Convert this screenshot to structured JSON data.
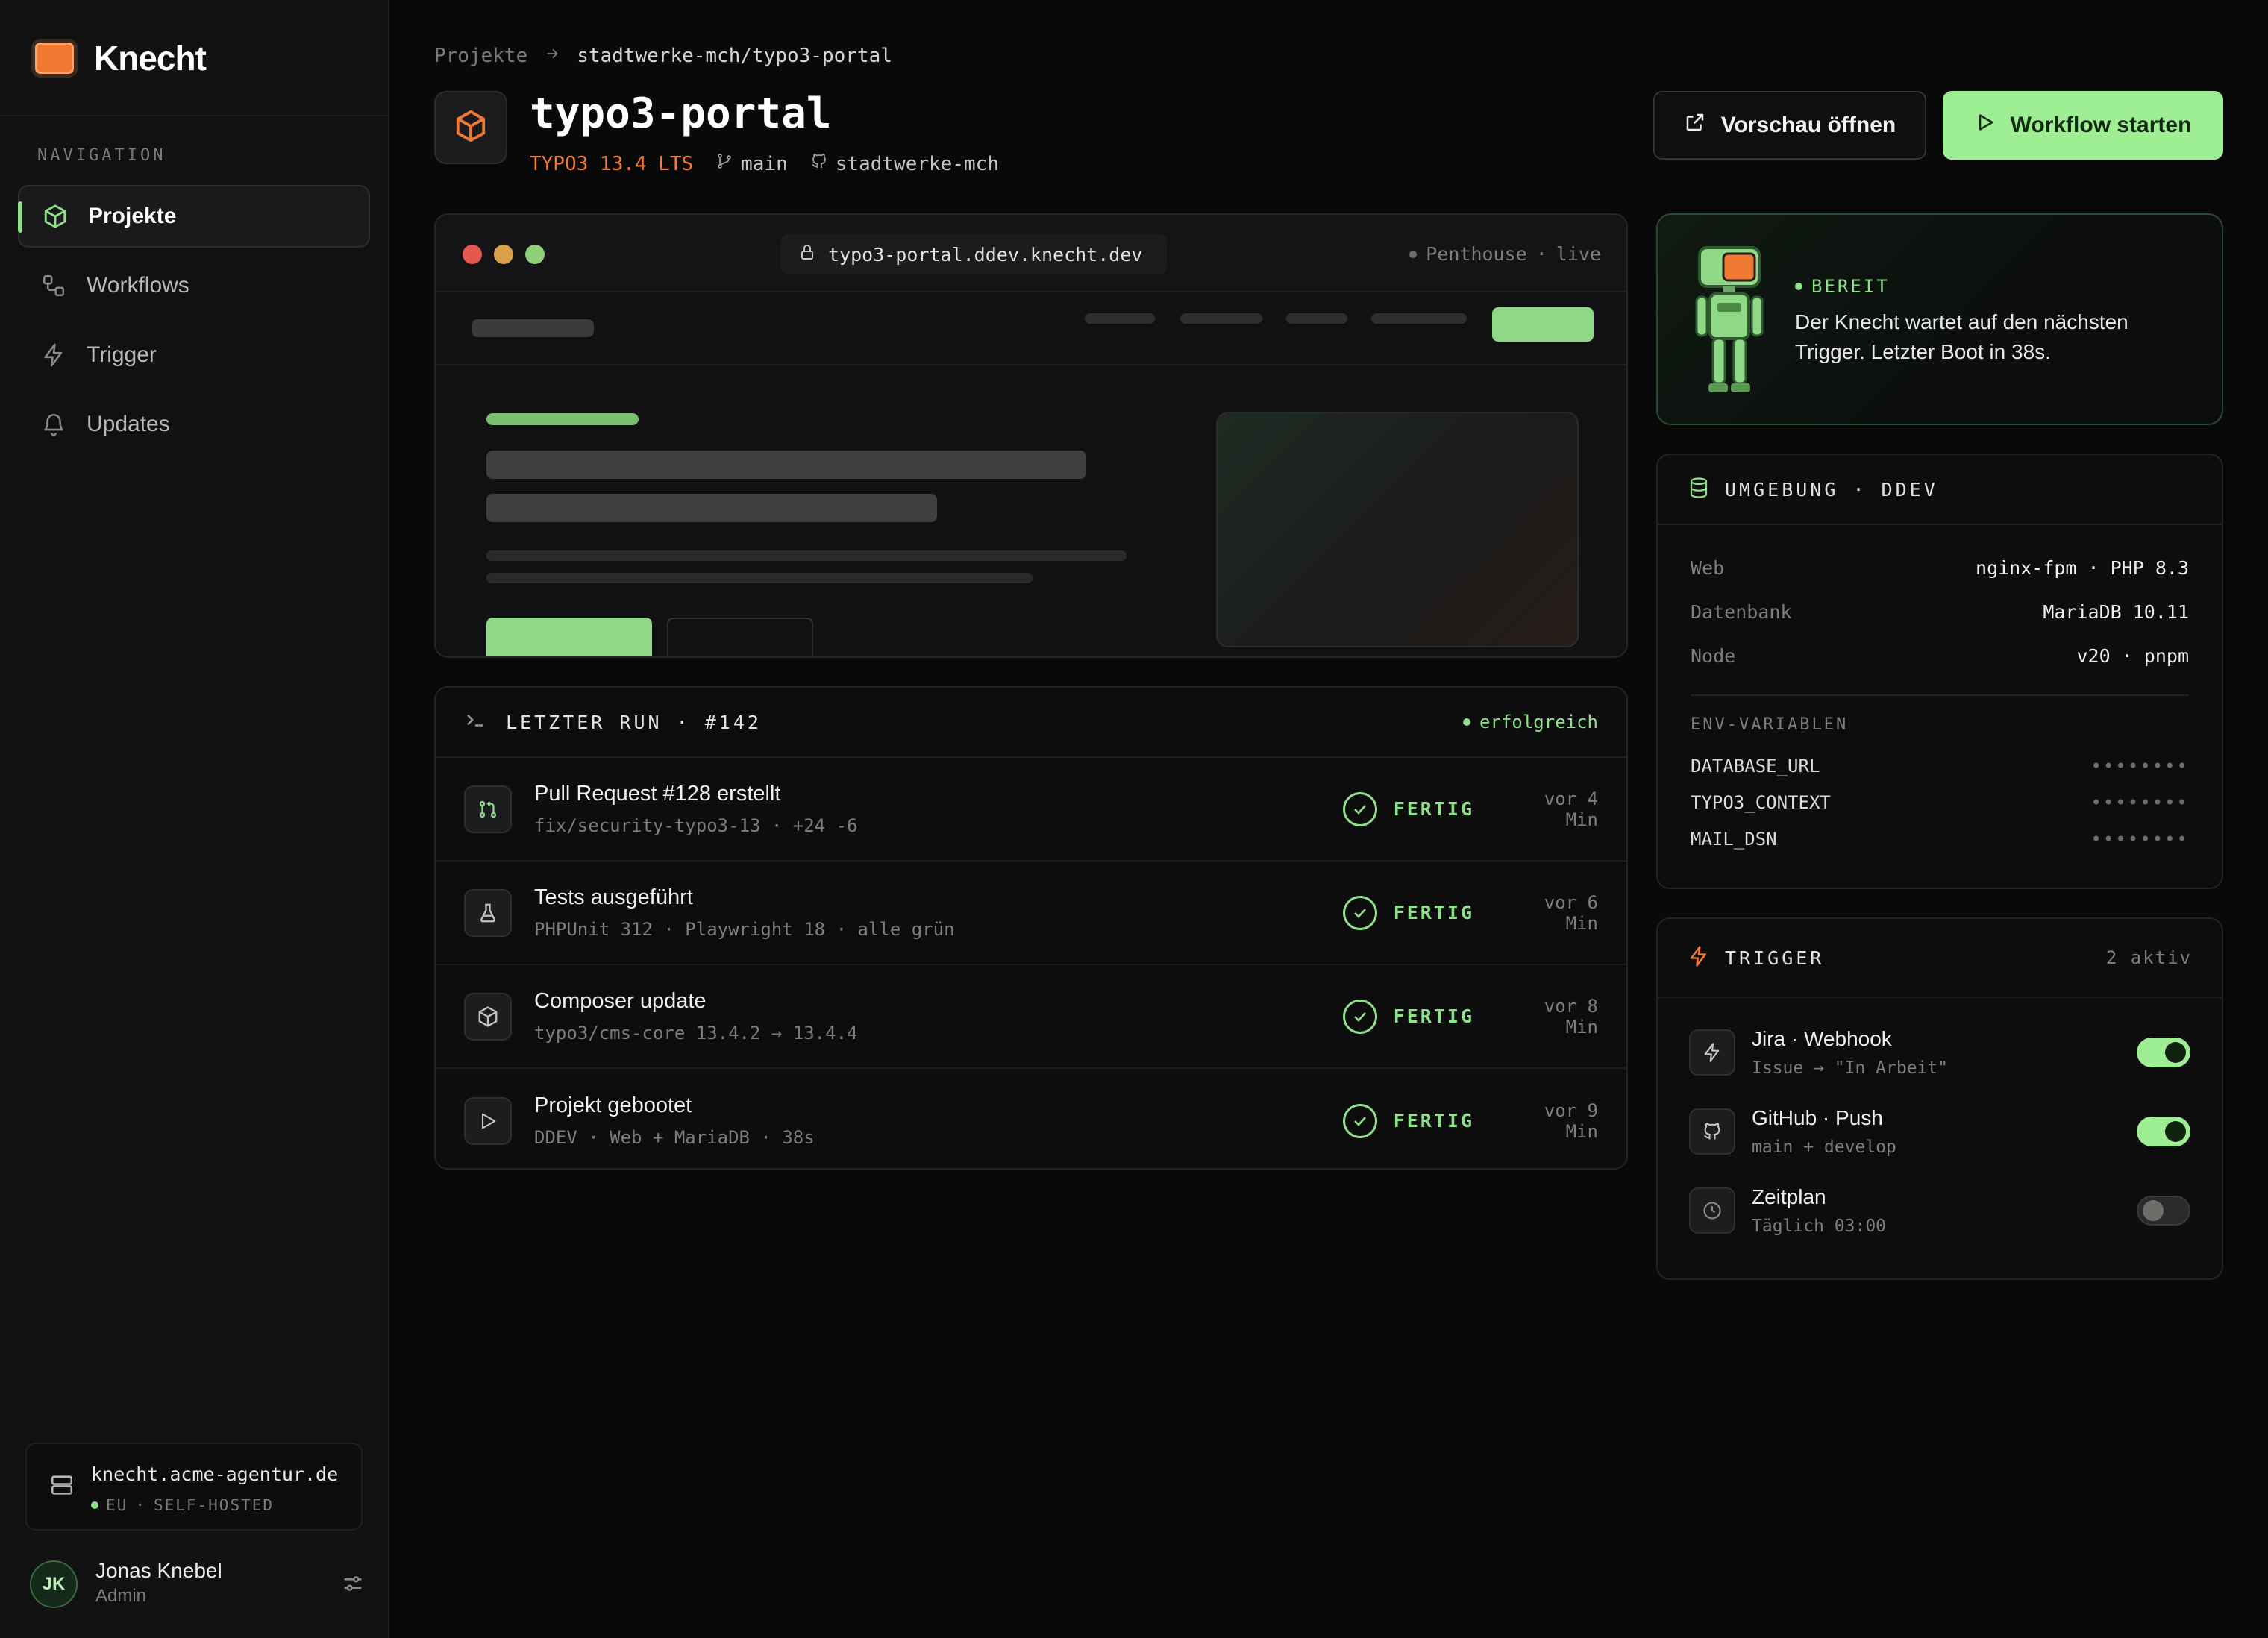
{
  "brand": {
    "name": "Knecht",
    "accent": "#f07a32"
  },
  "sidebar": {
    "heading": "NAVIGATION",
    "items": [
      {
        "label": "Projekte",
        "icon": "box-icon",
        "active": true
      },
      {
        "label": "Workflows",
        "icon": "workflow-icon",
        "active": false
      },
      {
        "label": "Trigger",
        "icon": "lightning-icon",
        "active": false
      },
      {
        "label": "Updates",
        "icon": "bell-icon",
        "active": false
      }
    ],
    "server": {
      "host": "knecht.acme-agentur.de",
      "region": "EU",
      "mode": "SELF-HOSTED"
    },
    "user": {
      "initials": "JK",
      "name": "Jonas Knebel",
      "role": "Admin"
    }
  },
  "header": {
    "breadcrumb": {
      "root": "Projekte",
      "current": "stadtwerke-mch/typo3-portal"
    },
    "title": "typo3-portal",
    "version": "TYPO3 13.4 LTS",
    "branch": "main",
    "org": "stadtwerke-mch",
    "preview_button": "Vorschau öffnen",
    "workflow_button": "Workflow starten"
  },
  "preview": {
    "url": "typo3-portal.ddev.knecht.dev",
    "server_name": "Penthouse",
    "state": "live"
  },
  "run": {
    "title": "LETZTER RUN · #142",
    "status": "erfolgreich",
    "steps": [
      {
        "title": "Pull Request #128 erstellt",
        "sub": "fix/security-typo3-13 · +24 -6",
        "icon": "git-pull-request-icon",
        "state": "FERTIG",
        "time": "vor 4 Min"
      },
      {
        "title": "Tests ausgeführt",
        "sub": "PHPUnit 312 · Playwright 18 · alle grün",
        "icon": "flask-icon",
        "state": "FERTIG",
        "time": "vor 6 Min"
      },
      {
        "title": "Composer update",
        "sub": "typo3/cms-core 13.4.2 → 13.4.4",
        "icon": "package-icon",
        "state": "FERTIG",
        "time": "vor 8 Min"
      },
      {
        "title": "Projekt gebootet",
        "sub": "DDEV · Web + MariaDB · 38s",
        "icon": "play-icon",
        "state": "FERTIG",
        "time": "vor 9 Min"
      }
    ]
  },
  "agent": {
    "status": "BEREIT",
    "message": "Der Knecht wartet auf den nächsten Trigger. Letzter Boot in 38s."
  },
  "environment": {
    "title": "UMGEBUNG · DDEV",
    "rows": [
      {
        "key": "Web",
        "value": "nginx-fpm · PHP 8.3"
      },
      {
        "key": "Datenbank",
        "value": "MariaDB 10.11"
      },
      {
        "key": "Node",
        "value": "v20 · pnpm"
      }
    ],
    "env_heading": "ENV-VARIABLEN",
    "env_vars": [
      {
        "key": "DATABASE_URL",
        "value": "••••••••"
      },
      {
        "key": "TYPO3_CONTEXT",
        "value": "••••••••"
      },
      {
        "key": "MAIL_DSN",
        "value": "••••••••"
      }
    ]
  },
  "triggers": {
    "title": "TRIGGER",
    "count": "2 aktiv",
    "items": [
      {
        "title": "Jira · Webhook",
        "sub": "Issue → \"In Arbeit\"",
        "icon": "lightning-icon",
        "enabled": true
      },
      {
        "title": "GitHub · Push",
        "sub": "main + develop",
        "icon": "github-icon",
        "enabled": true
      },
      {
        "title": "Zeitplan",
        "sub": "Täglich 03:00",
        "icon": "clock-icon",
        "enabled": false
      }
    ]
  },
  "colors": {
    "accent_green": "#9eef94",
    "success": "#8fe08a",
    "brand_orange": "#f07a32"
  }
}
